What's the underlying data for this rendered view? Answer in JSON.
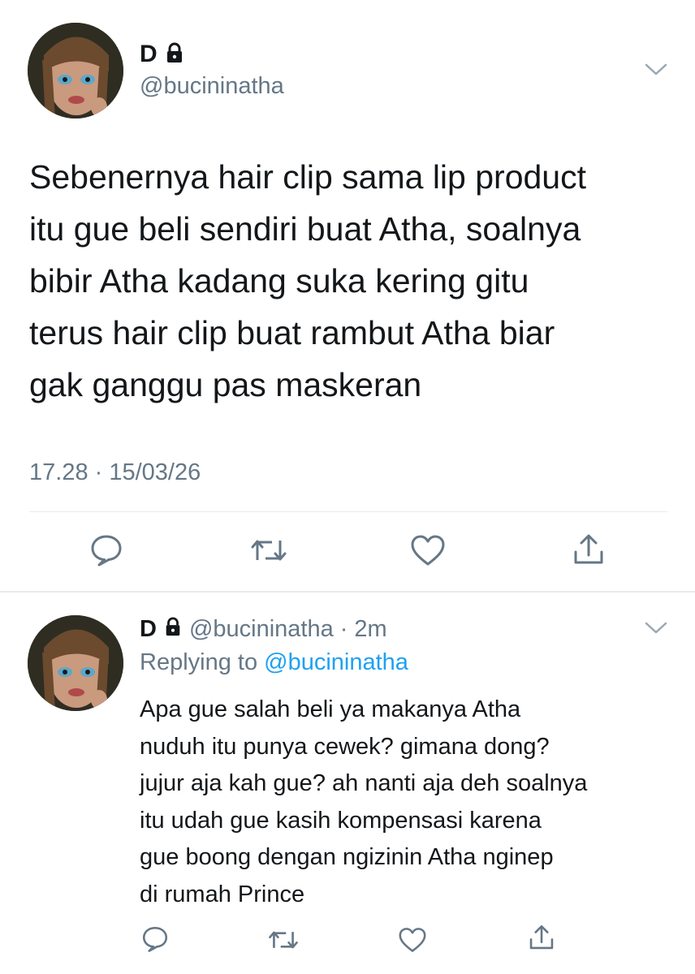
{
  "main_tweet": {
    "display_name": "D",
    "handle": "@bucininatha",
    "text_lines": [
      "Sebenernya hair clip sama lip product",
      "itu gue beli sendiri buat Atha, soalnya",
      "bibir Atha kadang suka kering gitu",
      "terus hair clip buat rambut Atha biar",
      "gak ganggu pas maskeran"
    ],
    "timestamp": "17.28 · 15/03/26",
    "actions": [
      "comment-icon",
      "retweet-icon",
      "like-icon",
      "share-icon"
    ]
  },
  "reply_tweet": {
    "display_name": "D",
    "handle": "@bucininatha",
    "time": "2m",
    "separator": "·",
    "replying_label": "Replying to",
    "replying_handle": "@bucininatha",
    "text_lines": [
      "Apa gue salah beli ya makanya Atha",
      "nuduh itu punya cewek? gimana dong?",
      "jujur aja kah gue? ah nanti aja deh soalnya",
      "itu udah gue kasih kompensasi karena",
      "gue boong dengan ngizinin Atha nginep",
      "di rumah Prince"
    ],
    "actions": [
      "comment-icon",
      "retweet-icon",
      "like-icon",
      "share-icon"
    ]
  },
  "colors": {
    "text": "#14171a",
    "muted": "#657786",
    "link": "#1da1f2",
    "divider": "#e6ecf0"
  }
}
